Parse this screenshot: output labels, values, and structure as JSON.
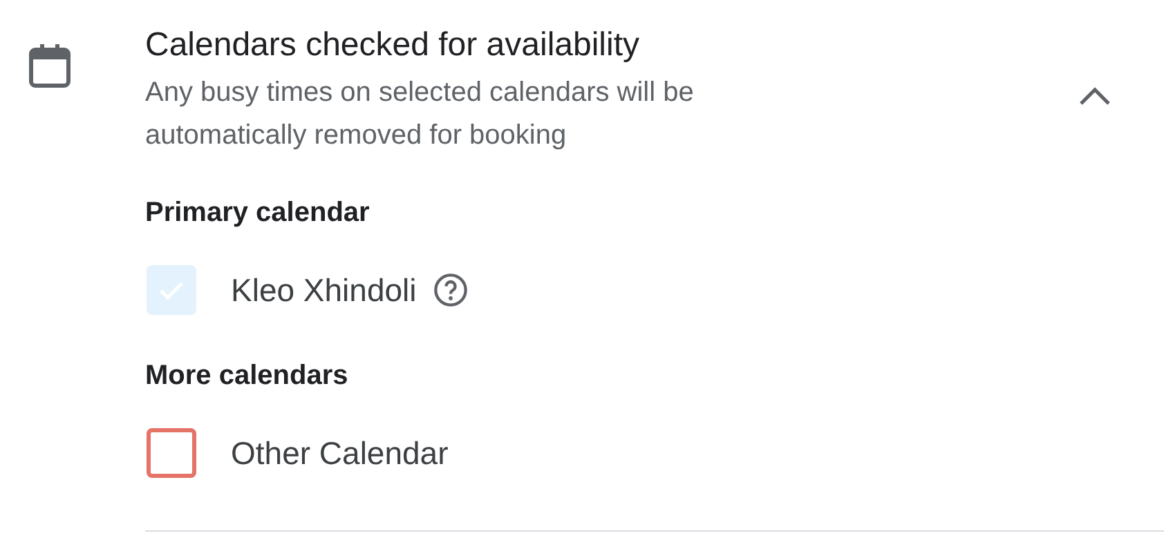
{
  "section": {
    "title": "Calendars checked for availability",
    "description": "Any busy times on selected calendars will be automatically removed for booking",
    "expanded": true
  },
  "groups": [
    {
      "heading": "Primary calendar",
      "calendars": [
        {
          "name": "Kleo Xhindoli",
          "checked": true,
          "disabled": true,
          "help": true
        }
      ]
    },
    {
      "heading": "More calendars",
      "calendars": [
        {
          "name": "Other Calendar",
          "checked": false,
          "disabled": false,
          "color": "#e57368"
        }
      ]
    }
  ]
}
